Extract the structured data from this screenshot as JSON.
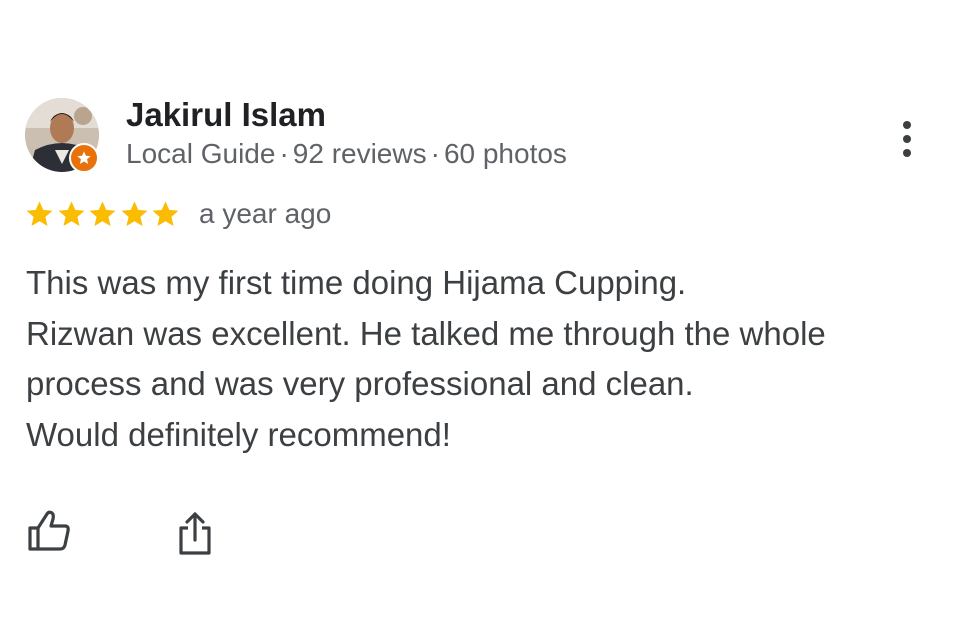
{
  "reviewer": {
    "name": "Jakirul Islam",
    "badge": "Local Guide",
    "reviews": "92 reviews",
    "photos": "60 photos",
    "separator": "·"
  },
  "review": {
    "rating": 5,
    "max_rating": 5,
    "time": "a year ago",
    "lines": [
      "This was my first time doing Hijama Cupping.",
      "Rizwan was excellent. He talked me through the whole",
      "process and was very professional and clean.",
      "Would definitely recommend!"
    ]
  },
  "actions": {
    "like_icon": "thumbs-up-icon",
    "share_icon": "share-icon",
    "more_icon": "more-vert-icon"
  },
  "colors": {
    "star": "#fbbc04",
    "guide_badge": "#e8710a",
    "name": "#202124",
    "meta": "#5f6368",
    "body_text": "#3c4043"
  }
}
